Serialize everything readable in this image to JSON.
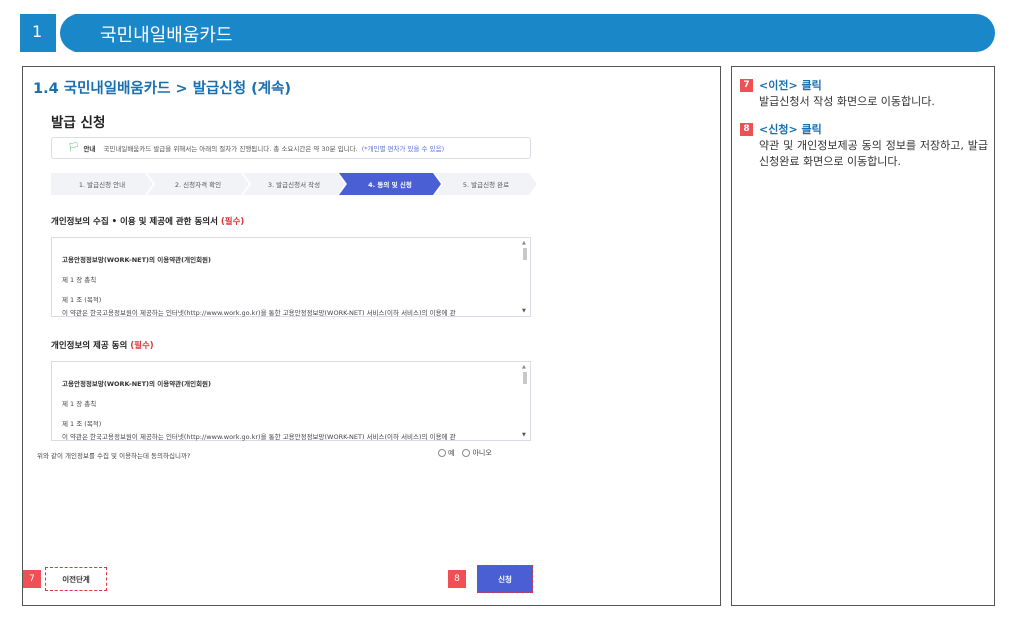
{
  "header": {
    "number": "1",
    "title": "국민내일배움카드"
  },
  "main": {
    "section_title": "1.4 국민내일배움카드 > 발급신청 (계속)",
    "page_heading": "발급 신청",
    "notice": {
      "label": "안내",
      "text": "국민내일배움카드 발급을 위해서는 아래의 절차가 진행됩니다. 총 소요시간은 약 30분 입니다.",
      "note": "(*개인별 편차가 있을 수 있음)"
    },
    "steps": [
      {
        "label": "1. 발급신청 안내",
        "active": false
      },
      {
        "label": "2. 신청자격 확인",
        "active": false
      },
      {
        "label": "3. 발급신청서 작성",
        "active": false
      },
      {
        "label": "4. 동의 및 신청",
        "active": true
      },
      {
        "label": "5. 발급신청 완료",
        "active": false
      }
    ],
    "consent1": {
      "heading": "개인정보의 수집 • 이용 및 제공에 관한 동의서",
      "required": "(필수)",
      "terms_title": "고용안정정보망(WORK-NET)의 이용약관(개인회원)",
      "line1": "제 1 장 총칙",
      "line2": "제 1 조 (목적)",
      "line3": "이 약관은 한국고용정보원이 제공하는 인터넷(http://www.work.go.kr)을 통한 고용안정정보망(WORK-NET) 서비스(이하 서비스)의 이용에 관"
    },
    "consent2": {
      "heading": "개인정보의 제공 동의",
      "required": "(필수)",
      "terms_title": "고용안정정보망(WORK-NET)의 이용약관(개인회원)",
      "line1": "제 1 장 총칙",
      "line2": "제 1 조 (목적)",
      "line3": "이 약관은 한국고용정보원이 제공하는 인터넷(http://www.work.go.kr)을 통한 고용안정정보망(WORK-NET) 서비스(이하 서비스)의 이용에 관"
    },
    "agree_question": "위와 같이 개인정보를 수집 및 이용하는데 동의하십니까?",
    "agree_yes": "예",
    "agree_no": "아니오",
    "prev_button": "이전단계",
    "submit_button": "신청",
    "marker_prev": "7",
    "marker_submit": "8"
  },
  "side": {
    "items": [
      {
        "num": "7",
        "title": "<이전> 클릭",
        "body": "발급신청서 작성 화면으로 이동합니다."
      },
      {
        "num": "8",
        "title": "<신청> 클릭",
        "body": "약관 및 개인정보제공 동의 정보를 저장하고, 발급신청완료 화면으로 이동합니다."
      }
    ]
  },
  "colors": {
    "brand_blue": "#1a87c9",
    "step_active": "#4a5fd4",
    "marker_red": "#ef4f55",
    "required_red": "#e0353e"
  }
}
